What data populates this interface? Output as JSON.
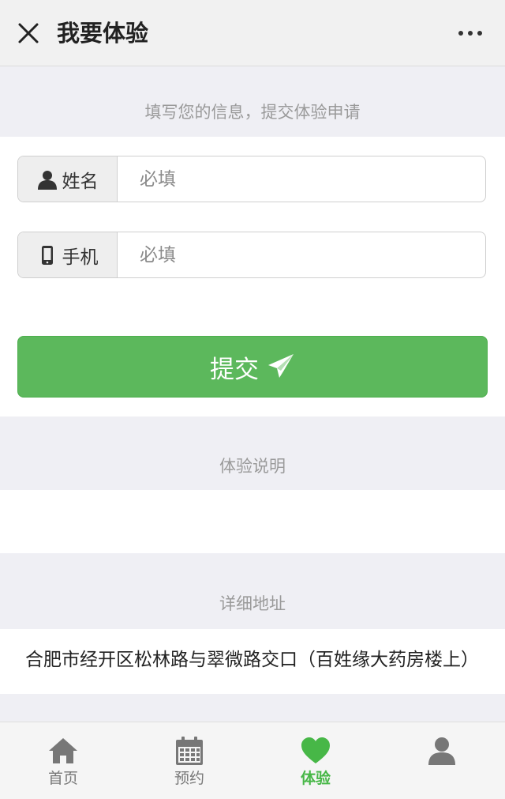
{
  "header": {
    "title": "我要体验",
    "close_icon": "close-icon",
    "more_icon": "more-dots-icon"
  },
  "form": {
    "hint": "填写您的信息，提交体验申请",
    "name": {
      "label": "姓名",
      "placeholder": "必填",
      "icon": "user-icon"
    },
    "phone": {
      "label": "手机",
      "placeholder": "必填",
      "icon": "mobile-phone-icon"
    },
    "submit_label": "提交",
    "submit_icon": "paper-plane-icon"
  },
  "sections": {
    "description_title": "体验说明",
    "address_title": "详细地址",
    "address_text": "合肥市经开区松林路与翠微路交口（百姓缘大药房楼上）"
  },
  "tabs": [
    {
      "label": "首页",
      "icon": "home-icon",
      "active": false
    },
    {
      "label": "预约",
      "icon": "calendar-icon",
      "active": false
    },
    {
      "label": "体验",
      "icon": "heart-icon",
      "active": true
    },
    {
      "label": "",
      "icon": "user-icon",
      "active": false
    }
  ],
  "colors": {
    "accent": "#5cb85c",
    "active_tab": "#47b747",
    "background": "#efeff4"
  }
}
